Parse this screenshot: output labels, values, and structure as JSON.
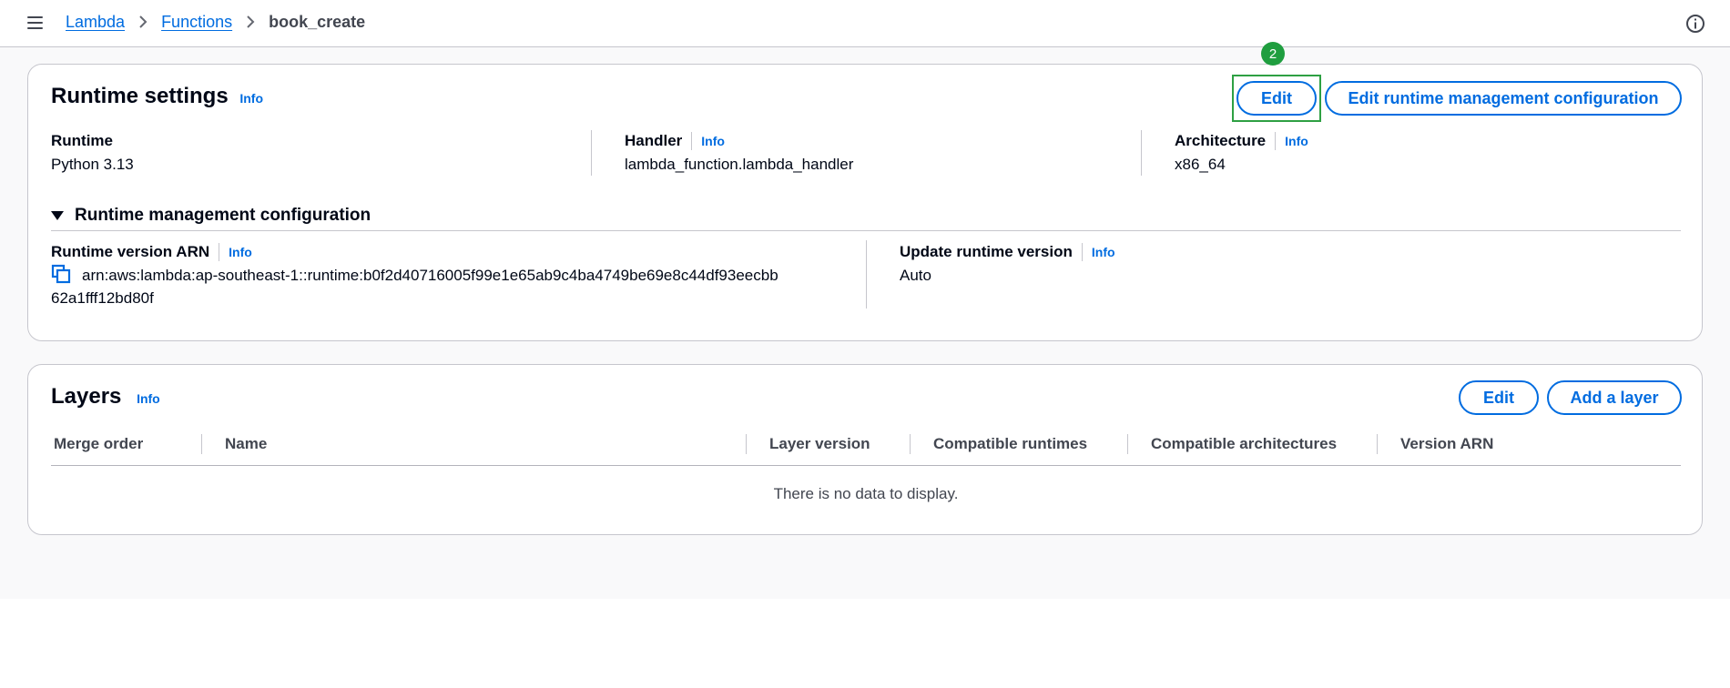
{
  "breadcrumb": {
    "items": [
      "Lambda",
      "Functions"
    ],
    "current": "book_create"
  },
  "runtime_settings": {
    "title": "Runtime settings",
    "info": "Info",
    "edit_label": "Edit",
    "edit_mgmt_label": "Edit runtime management configuration",
    "step_badge": "2",
    "runtime": {
      "label": "Runtime",
      "value": "Python 3.13"
    },
    "handler": {
      "label": "Handler",
      "info": "Info",
      "value": "lambda_function.lambda_handler"
    },
    "architecture": {
      "label": "Architecture",
      "info": "Info",
      "value": "x86_64"
    },
    "mgmt_config": {
      "title": "Runtime management configuration",
      "arn": {
        "label": "Runtime version ARN",
        "info": "Info",
        "value_line1": "arn:aws:lambda:ap-southeast-1::runtime:b0f2d40716005f99e1e65ab9c4ba4749be69e8c44df93eecbb",
        "value_line2": "62a1fff12bd80f"
      },
      "update": {
        "label": "Update runtime version",
        "info": "Info",
        "value": "Auto"
      }
    }
  },
  "layers": {
    "title": "Layers",
    "info": "Info",
    "edit_label": "Edit",
    "add_label": "Add a layer",
    "columns": [
      "Merge order",
      "Name",
      "Layer version",
      "Compatible runtimes",
      "Compatible architectures",
      "Version ARN"
    ],
    "empty_text": "There is no data to display."
  },
  "colors": {
    "link": "#006ce0",
    "highlight": "#2ea043",
    "badge": "#1f9e3f",
    "border": "#c6c6cd"
  }
}
